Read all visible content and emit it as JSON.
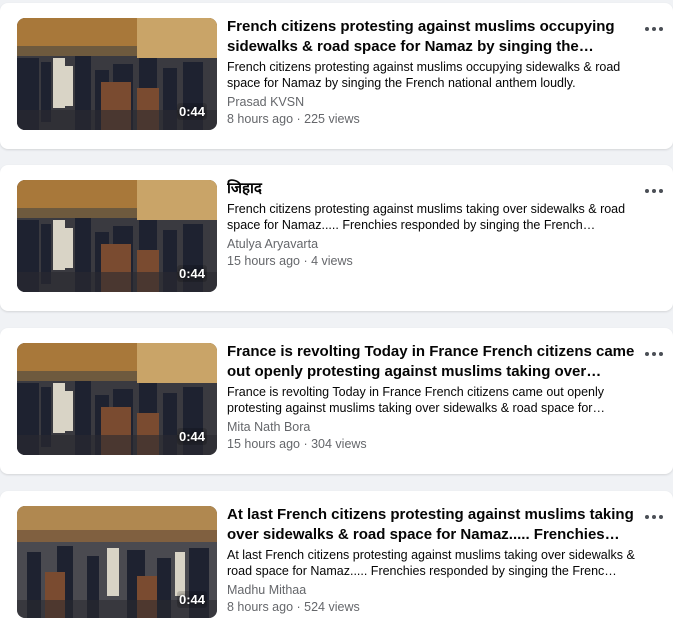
{
  "videos": [
    {
      "title": "French citizens protesting against muslims occupying sidewalks & road space for Namaz by singing the French…",
      "description": "French citizens protesting against muslims occupying sidewalks & road space for Namaz by singing the French national anthem loudly.",
      "author": "Prasad KVSN",
      "meta": "8 hours ago · 225 views",
      "duration": "0:44",
      "more_icon": "more-horizontal-icon"
    },
    {
      "title": "जिहाद",
      "description": "French citizens protesting against muslims taking over sidewalks & road space for Namaz..... Frenchies responded by singing the French…",
      "author": "Atulya Aryavarta",
      "meta": "15 hours ago · 4 views",
      "duration": "0:44",
      "more_icon": "more-horizontal-icon"
    },
    {
      "title": "France is revolting Today in France French citizens came out openly protesting against muslims taking over sidewalks …",
      "description": "France is revolting Today in France French citizens came out openly protesting against muslims taking over sidewalks & road space for…",
      "author": "Mita Nath Bora",
      "meta": "15 hours ago · 304 views",
      "duration": "0:44",
      "more_icon": "more-horizontal-icon"
    },
    {
      "title": "At last French citizens protesting against muslims taking over sidewalks & road space for Namaz..... Frenchies…",
      "description": "At last French citizens protesting against muslims taking over sidewalks & road space for Namaz..... Frenchies responded by singing the Frenc…",
      "author": "Madhu Mithaa",
      "meta": "8 hours ago · 524 views",
      "duration": "0:44",
      "more_icon": "more-horizontal-icon"
    }
  ]
}
